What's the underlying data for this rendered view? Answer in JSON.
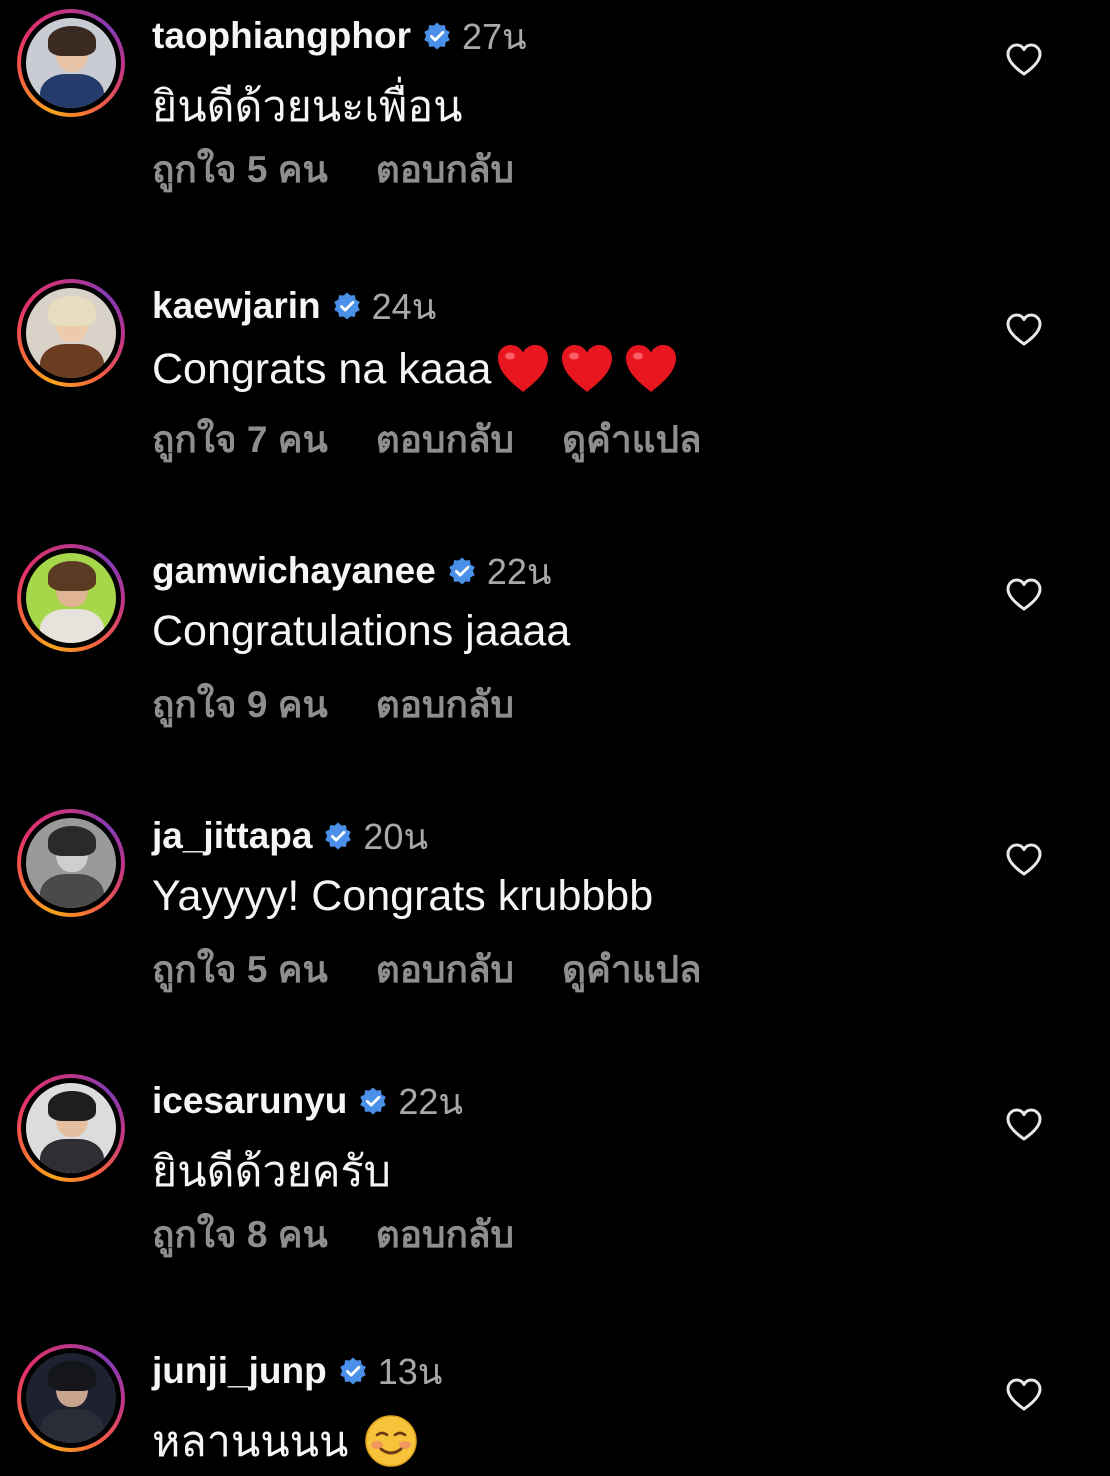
{
  "colors": {
    "background": "#000000",
    "username": "#f5f5f5",
    "meta": "#a8a8a8",
    "action": "#8e8e8e",
    "verified": "#4a90e8",
    "heart_emoji": "#e8161f"
  },
  "comments": [
    {
      "username": "taophiangphor",
      "verified": true,
      "time": "27น",
      "text": "ยินดีด้วยนะเพื่อน",
      "likes": "ถูกใจ 5 คน",
      "reply": "ตอบกลับ",
      "translate": "",
      "avatar_colors": {
        "bg": "#c9ccd3",
        "hair": "#3b2a22",
        "skin": "#e8c4a8",
        "body": "#243b6b"
      }
    },
    {
      "username": "kaewjarin",
      "verified": true,
      "time": "24น",
      "text": "Congrats na kaaa",
      "emoji": "heart-emoji x3",
      "likes": "ถูกใจ 7 คน",
      "reply": "ตอบกลับ",
      "translate": "ดูคำแปล",
      "avatar_colors": {
        "bg": "#d8d2c8",
        "hair": "#e8dcc0",
        "skin": "#eccaaa",
        "body": "#6b3b22"
      }
    },
    {
      "username": "gamwichayanee",
      "verified": true,
      "time": "22น",
      "text": "Congratulations jaaaa",
      "likes": "ถูกใจ 9 คน",
      "reply": "ตอบกลับ",
      "translate": "",
      "avatar_colors": {
        "bg": "#a6d64a",
        "hair": "#5a3a22",
        "skin": "#e0b494",
        "body": "#e8e2dc"
      }
    },
    {
      "username": "ja_jittapa",
      "verified": true,
      "time": "20น",
      "text": "Yayyyy! Congrats krubbbb",
      "likes": "ถูกใจ 5 คน",
      "reply": "ตอบกลับ",
      "translate": "ดูคำแปล",
      "avatar_colors": {
        "bg": "#9a9a9a",
        "hair": "#2a2a2a",
        "skin": "#cfcfcf",
        "body": "#4a4a4a"
      }
    },
    {
      "username": "icesarunyu",
      "verified": true,
      "time": "22น",
      "text": "ยินดีด้วยครับ",
      "likes": "ถูกใจ 8 คน",
      "reply": "ตอบกลับ",
      "translate": "",
      "avatar_colors": {
        "bg": "#dcdcdc",
        "hair": "#1e1e1e",
        "skin": "#e4bfa0",
        "body": "#2e2e34"
      }
    },
    {
      "username": "junji_junp",
      "verified": true,
      "time": "13น",
      "text": "หลานนนน",
      "emoji": "smiling-blush-emoji",
      "likes": "",
      "reply": "",
      "translate": "",
      "avatar_colors": {
        "bg": "#1e2230",
        "hair": "#15161c",
        "skin": "#c8a48c",
        "body": "#2a2c38"
      }
    }
  ]
}
